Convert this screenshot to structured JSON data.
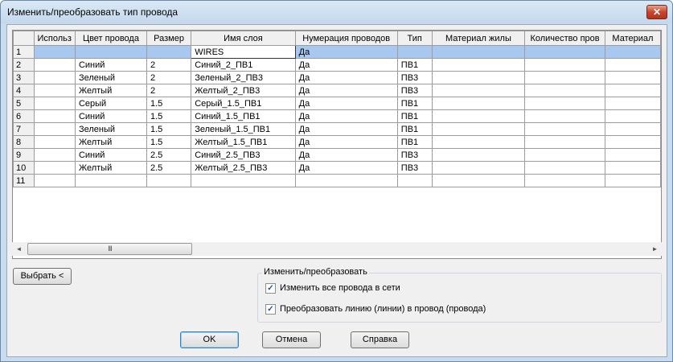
{
  "window": {
    "title": "Изменить/преобразовать тип провода",
    "close_glyph": "✕"
  },
  "grid": {
    "columns": [
      "Использ",
      "Цвет провода",
      "Размер",
      "Имя слоя",
      "Нумерация проводов",
      "Тип",
      "Материал жилы",
      "Количество пров",
      "Материал"
    ],
    "rows": [
      {
        "num": "1",
        "cells": [
          "",
          "",
          "",
          "WIRES",
          "Да",
          "",
          "",
          "",
          ""
        ]
      },
      {
        "num": "2",
        "cells": [
          "",
          "Синий",
          "2",
          "Синий_2_ПВ1",
          "Да",
          "ПВ1",
          "",
          "",
          ""
        ]
      },
      {
        "num": "3",
        "cells": [
          "",
          "Зеленый",
          "2",
          "Зеленый_2_ПВ3",
          "Да",
          "ПВ3",
          "",
          "",
          ""
        ]
      },
      {
        "num": "4",
        "cells": [
          "",
          "Желтый",
          "2",
          "Желтый_2_ПВ3",
          "Да",
          "ПВ3",
          "",
          "",
          ""
        ]
      },
      {
        "num": "5",
        "cells": [
          "",
          "Серый",
          "1.5",
          "Серый_1.5_ПВ1",
          "Да",
          "ПВ1",
          "",
          "",
          ""
        ]
      },
      {
        "num": "6",
        "cells": [
          "",
          "Синий",
          "1.5",
          "Синий_1.5_ПВ1",
          "Да",
          "ПВ1",
          "",
          "",
          ""
        ]
      },
      {
        "num": "7",
        "cells": [
          "",
          "Зеленый",
          "1.5",
          "Зеленый_1.5_ПВ1",
          "Да",
          "ПВ1",
          "",
          "",
          ""
        ]
      },
      {
        "num": "8",
        "cells": [
          "",
          "Желтый",
          "1.5",
          "Желтый_1.5_ПВ1",
          "Да",
          "ПВ1",
          "",
          "",
          ""
        ]
      },
      {
        "num": "9",
        "cells": [
          "",
          "Синий",
          "2.5",
          "Синий_2.5_ПВ3",
          "Да",
          "ПВ3",
          "",
          "",
          ""
        ]
      },
      {
        "num": "10",
        "cells": [
          "",
          "Желтый",
          "2.5",
          "Желтый_2.5_ПВ3",
          "Да",
          "ПВ3",
          "",
          "",
          ""
        ]
      },
      {
        "num": "11",
        "cells": [
          "",
          "",
          "",
          "",
          "",
          "",
          "",
          "",
          ""
        ]
      }
    ],
    "selected_row": 0,
    "current_cell_col": 3
  },
  "scrollbar": {
    "left_glyph": "◄",
    "right_glyph": "►",
    "thumb_grip": "III"
  },
  "buttons": {
    "select": "Выбрать <",
    "ok": "OK",
    "cancel": "Отмена",
    "help": "Справка"
  },
  "group": {
    "legend": "Изменить/преобразовать",
    "options": [
      {
        "label": "Изменить все провода в сети",
        "checked": true
      },
      {
        "label": "Преобразовать линию (линии) в провод (провода)",
        "checked": true
      }
    ],
    "check_glyph": "✓"
  },
  "colors": {
    "selection": "#a8c8f0",
    "title_bg": "#c4d8ec",
    "close_red": "#c7452c"
  }
}
